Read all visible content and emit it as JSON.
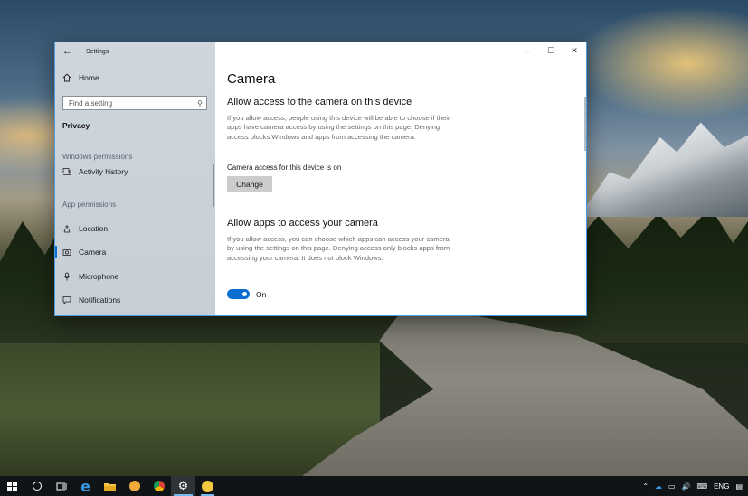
{
  "window": {
    "app_title": "Settings",
    "controls": {
      "minimize": "–",
      "maximize": "☐",
      "close": "✕"
    }
  },
  "sidebar": {
    "home": "Home",
    "search": {
      "placeholder": "Find a setting"
    },
    "section": "Privacy",
    "windows_permissions_label": "Windows permissions",
    "activity_history": "Activity history",
    "app_permissions_label": "App permissions",
    "items": [
      {
        "label": "Location",
        "icon": "location-icon"
      },
      {
        "label": "Camera",
        "icon": "camera-icon",
        "selected": true
      },
      {
        "label": "Microphone",
        "icon": "microphone-icon"
      },
      {
        "label": "Notifications",
        "icon": "notifications-icon"
      }
    ]
  },
  "main": {
    "title": "Camera",
    "device_heading": "Allow access to the camera on this device",
    "device_description": "If you allow access, people using this device will be able to choose if their apps have camera access by using the settings on this page. Denying access blocks Windows and apps from accessing the camera.",
    "device_status": "Camera access for this device is on",
    "change_button": "Change",
    "apps_heading": "Allow apps to access your camera",
    "apps_description": "If you allow access, you can choose which apps can access your camera by using the settings on this page. Denying access only blocks apps from accessing your camera. It does not block Windows.",
    "toggle": {
      "state": "On",
      "on": true
    }
  },
  "taskbar": {
    "items": [
      "start-icon",
      "cortana-icon",
      "task-view-icon",
      "edge-icon",
      "file-explorer-icon",
      "app-icon",
      "chrome-icon",
      "settings-icon",
      "emoji-app-icon"
    ],
    "language": "ENG",
    "accent": "#76b9ed"
  },
  "colors": {
    "accent": "#0a6ed1"
  }
}
